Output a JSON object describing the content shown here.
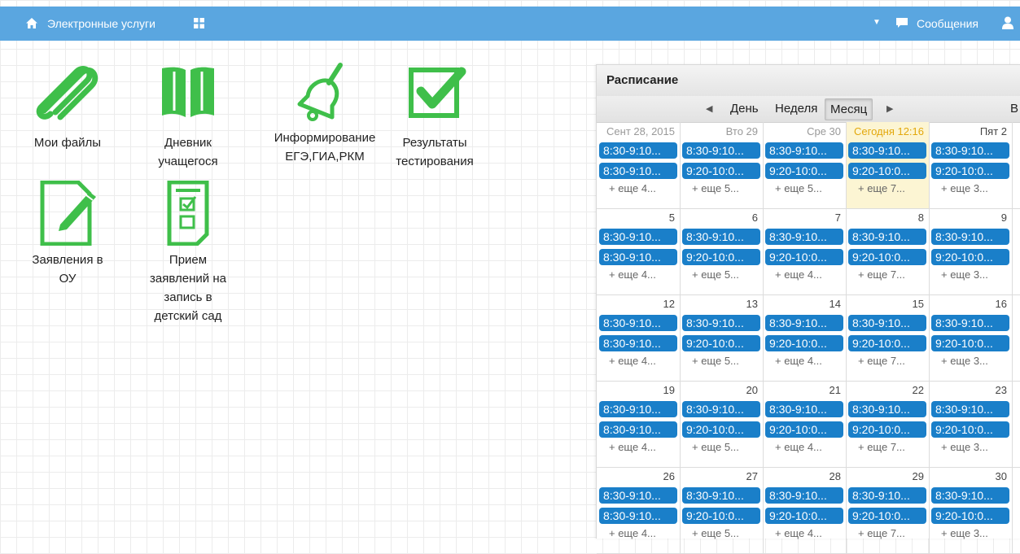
{
  "topbar": {
    "title": "Электронные услуги",
    "messages": "Сообщения"
  },
  "tiles": [
    {
      "label": "Мои файлы"
    },
    {
      "label": "Дневник\nучащегося"
    },
    {
      "label": "Информирование\nЕГЭ,ГИА,РКМ"
    },
    {
      "label": "Результаты\nтестирования"
    },
    {
      "label": "Заявления в\nОУ"
    },
    {
      "label": "Прием\nзаявлений на\nзапись в\nдетский сад"
    }
  ],
  "schedule": {
    "title": "Расписание",
    "toolbar": {
      "day": "День",
      "week": "Неделя",
      "month": "Месяц",
      "cut": "В"
    },
    "weeks": [
      {
        "days": [
          {
            "label": "Сент 28, 2015",
            "e1": "8:30-9:10...",
            "e2": "8:30-9:10...",
            "more": "+ еще 4..."
          },
          {
            "label": "Вто 29",
            "e1": "8:30-9:10...",
            "e2": "9:20-10:0...",
            "more": "+ еще 5..."
          },
          {
            "label": "Сре 30",
            "e1": "8:30-9:10...",
            "e2": "9:20-10:0...",
            "more": "+ еще 5..."
          },
          {
            "label": "Сегодня 12:16",
            "e1": "8:30-9:10...",
            "e2": "9:20-10:0...",
            "more": "+ еще 7..."
          },
          {
            "label": "Пят 2",
            "e1": "8:30-9:10...",
            "e2": "9:20-10:0...",
            "more": "+ еще 3..."
          }
        ]
      },
      {
        "days": [
          {
            "label": "5",
            "e1": "8:30-9:10...",
            "e2": "8:30-9:10...",
            "more": "+ еще 4..."
          },
          {
            "label": "6",
            "e1": "8:30-9:10...",
            "e2": "9:20-10:0...",
            "more": "+ еще 5..."
          },
          {
            "label": "7",
            "e1": "8:30-9:10...",
            "e2": "9:20-10:0...",
            "more": "+ еще 4..."
          },
          {
            "label": "8",
            "e1": "8:30-9:10...",
            "e2": "9:20-10:0...",
            "more": "+ еще 7..."
          },
          {
            "label": "9",
            "e1": "8:30-9:10...",
            "e2": "9:20-10:0...",
            "more": "+ еще 3..."
          }
        ]
      },
      {
        "days": [
          {
            "label": "12",
            "e1": "8:30-9:10...",
            "e2": "8:30-9:10...",
            "more": "+ еще 4..."
          },
          {
            "label": "13",
            "e1": "8:30-9:10...",
            "e2": "9:20-10:0...",
            "more": "+ еще 5..."
          },
          {
            "label": "14",
            "e1": "8:30-9:10...",
            "e2": "9:20-10:0...",
            "more": "+ еще 4..."
          },
          {
            "label": "15",
            "e1": "8:30-9:10...",
            "e2": "9:20-10:0...",
            "more": "+ еще 7..."
          },
          {
            "label": "16",
            "e1": "8:30-9:10...",
            "e2": "9:20-10:0...",
            "more": "+ еще 3..."
          }
        ]
      },
      {
        "days": [
          {
            "label": "19",
            "e1": "8:30-9:10...",
            "e2": "8:30-9:10...",
            "more": "+ еще 4..."
          },
          {
            "label": "20",
            "e1": "8:30-9:10...",
            "e2": "9:20-10:0...",
            "more": "+ еще 5..."
          },
          {
            "label": "21",
            "e1": "8:30-9:10...",
            "e2": "9:20-10:0...",
            "more": "+ еще 4..."
          },
          {
            "label": "22",
            "e1": "8:30-9:10...",
            "e2": "9:20-10:0...",
            "more": "+ еще 7..."
          },
          {
            "label": "23",
            "e1": "8:30-9:10...",
            "e2": "9:20-10:0...",
            "more": "+ еще 3..."
          }
        ]
      },
      {
        "days": [
          {
            "label": "26",
            "e1": "8:30-9:10...",
            "e2": "8:30-9:10...",
            "more": "+ еще 4..."
          },
          {
            "label": "27",
            "e1": "8:30-9:10...",
            "e2": "9:20-10:0...",
            "more": "+ еще 5..."
          },
          {
            "label": "28",
            "e1": "8:30-9:10...",
            "e2": "9:20-10:0...",
            "more": "+ еще 4..."
          },
          {
            "label": "29",
            "e1": "8:30-9:10...",
            "e2": "9:20-10:0...",
            "more": "+ еще 7..."
          },
          {
            "label": "30",
            "e1": "8:30-9:10...",
            "e2": "9:20-10:0...",
            "more": "+ еще 3..."
          }
        ]
      }
    ]
  },
  "colors": {
    "topbar": "#5aa6e0",
    "icon_green": "#3fbf4a",
    "event_blue": "#1a7fc9",
    "today_bg": "#fcf5d3",
    "today_text": "#e3a80c"
  }
}
